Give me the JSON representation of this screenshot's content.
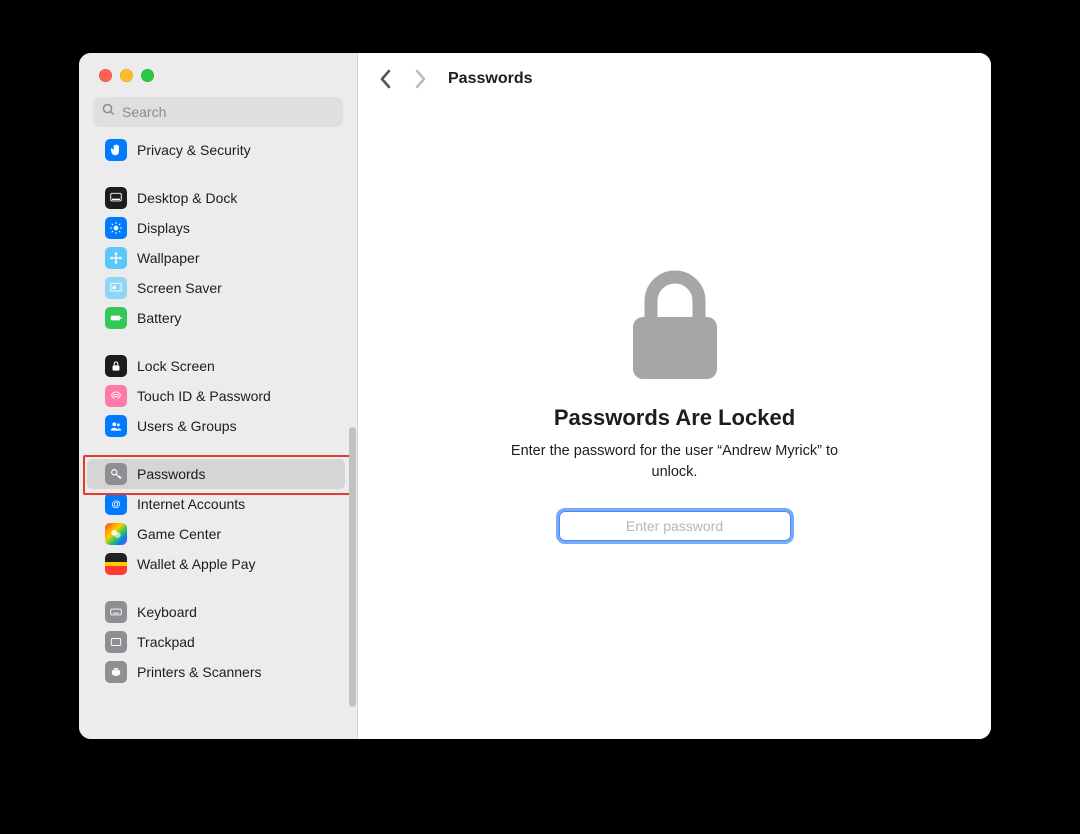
{
  "colors": {
    "accent": "#007aff",
    "highlight_box": "#e33b2e",
    "focus_ring": "#2f6fe8"
  },
  "search": {
    "placeholder_text": "Search",
    "value": ""
  },
  "sidebar": {
    "items": [
      {
        "label": "Privacy & Security",
        "icon": "hand-icon",
        "icon_class": "ic-blue"
      },
      {
        "label": "Desktop & Dock",
        "icon": "dock-icon",
        "icon_class": "ic-black"
      },
      {
        "label": "Displays",
        "icon": "sun-icon",
        "icon_class": "ic-blue"
      },
      {
        "label": "Wallpaper",
        "icon": "flower-icon",
        "icon_class": "ic-lblue"
      },
      {
        "label": "Screen Saver",
        "icon": "screensaver-icon",
        "icon_class": "ic-sky"
      },
      {
        "label": "Battery",
        "icon": "battery-icon",
        "icon_class": "ic-green"
      },
      {
        "label": "Lock Screen",
        "icon": "lockscreen-icon",
        "icon_class": "ic-black"
      },
      {
        "label": "Touch ID & Password",
        "icon": "fingerprint-icon",
        "icon_class": "ic-pink"
      },
      {
        "label": "Users & Groups",
        "icon": "users-icon",
        "icon_class": "ic-blue"
      },
      {
        "label": "Passwords",
        "icon": "key-icon",
        "icon_class": "ic-gray"
      },
      {
        "label": "Internet Accounts",
        "icon": "at-icon",
        "icon_class": "ic-blue"
      },
      {
        "label": "Game Center",
        "icon": "gamecenter-icon",
        "icon_class": "ic-multi"
      },
      {
        "label": "Wallet & Apple Pay",
        "icon": "wallet-icon",
        "icon_class": "ic-wallet"
      },
      {
        "label": "Keyboard",
        "icon": "keyboard-icon",
        "icon_class": "ic-gray"
      },
      {
        "label": "Trackpad",
        "icon": "trackpad-icon",
        "icon_class": "ic-gray"
      },
      {
        "label": "Printers & Scanners",
        "icon": "printer-icon",
        "icon_class": "ic-gray"
      }
    ],
    "selected_index": 9
  },
  "toolbar": {
    "title": "Passwords"
  },
  "locked_pane": {
    "title": "Passwords Are Locked",
    "subtitle": "Enter the password for the user “Andrew Myrick” to unlock.",
    "placeholder_text": "Enter password",
    "value": ""
  }
}
